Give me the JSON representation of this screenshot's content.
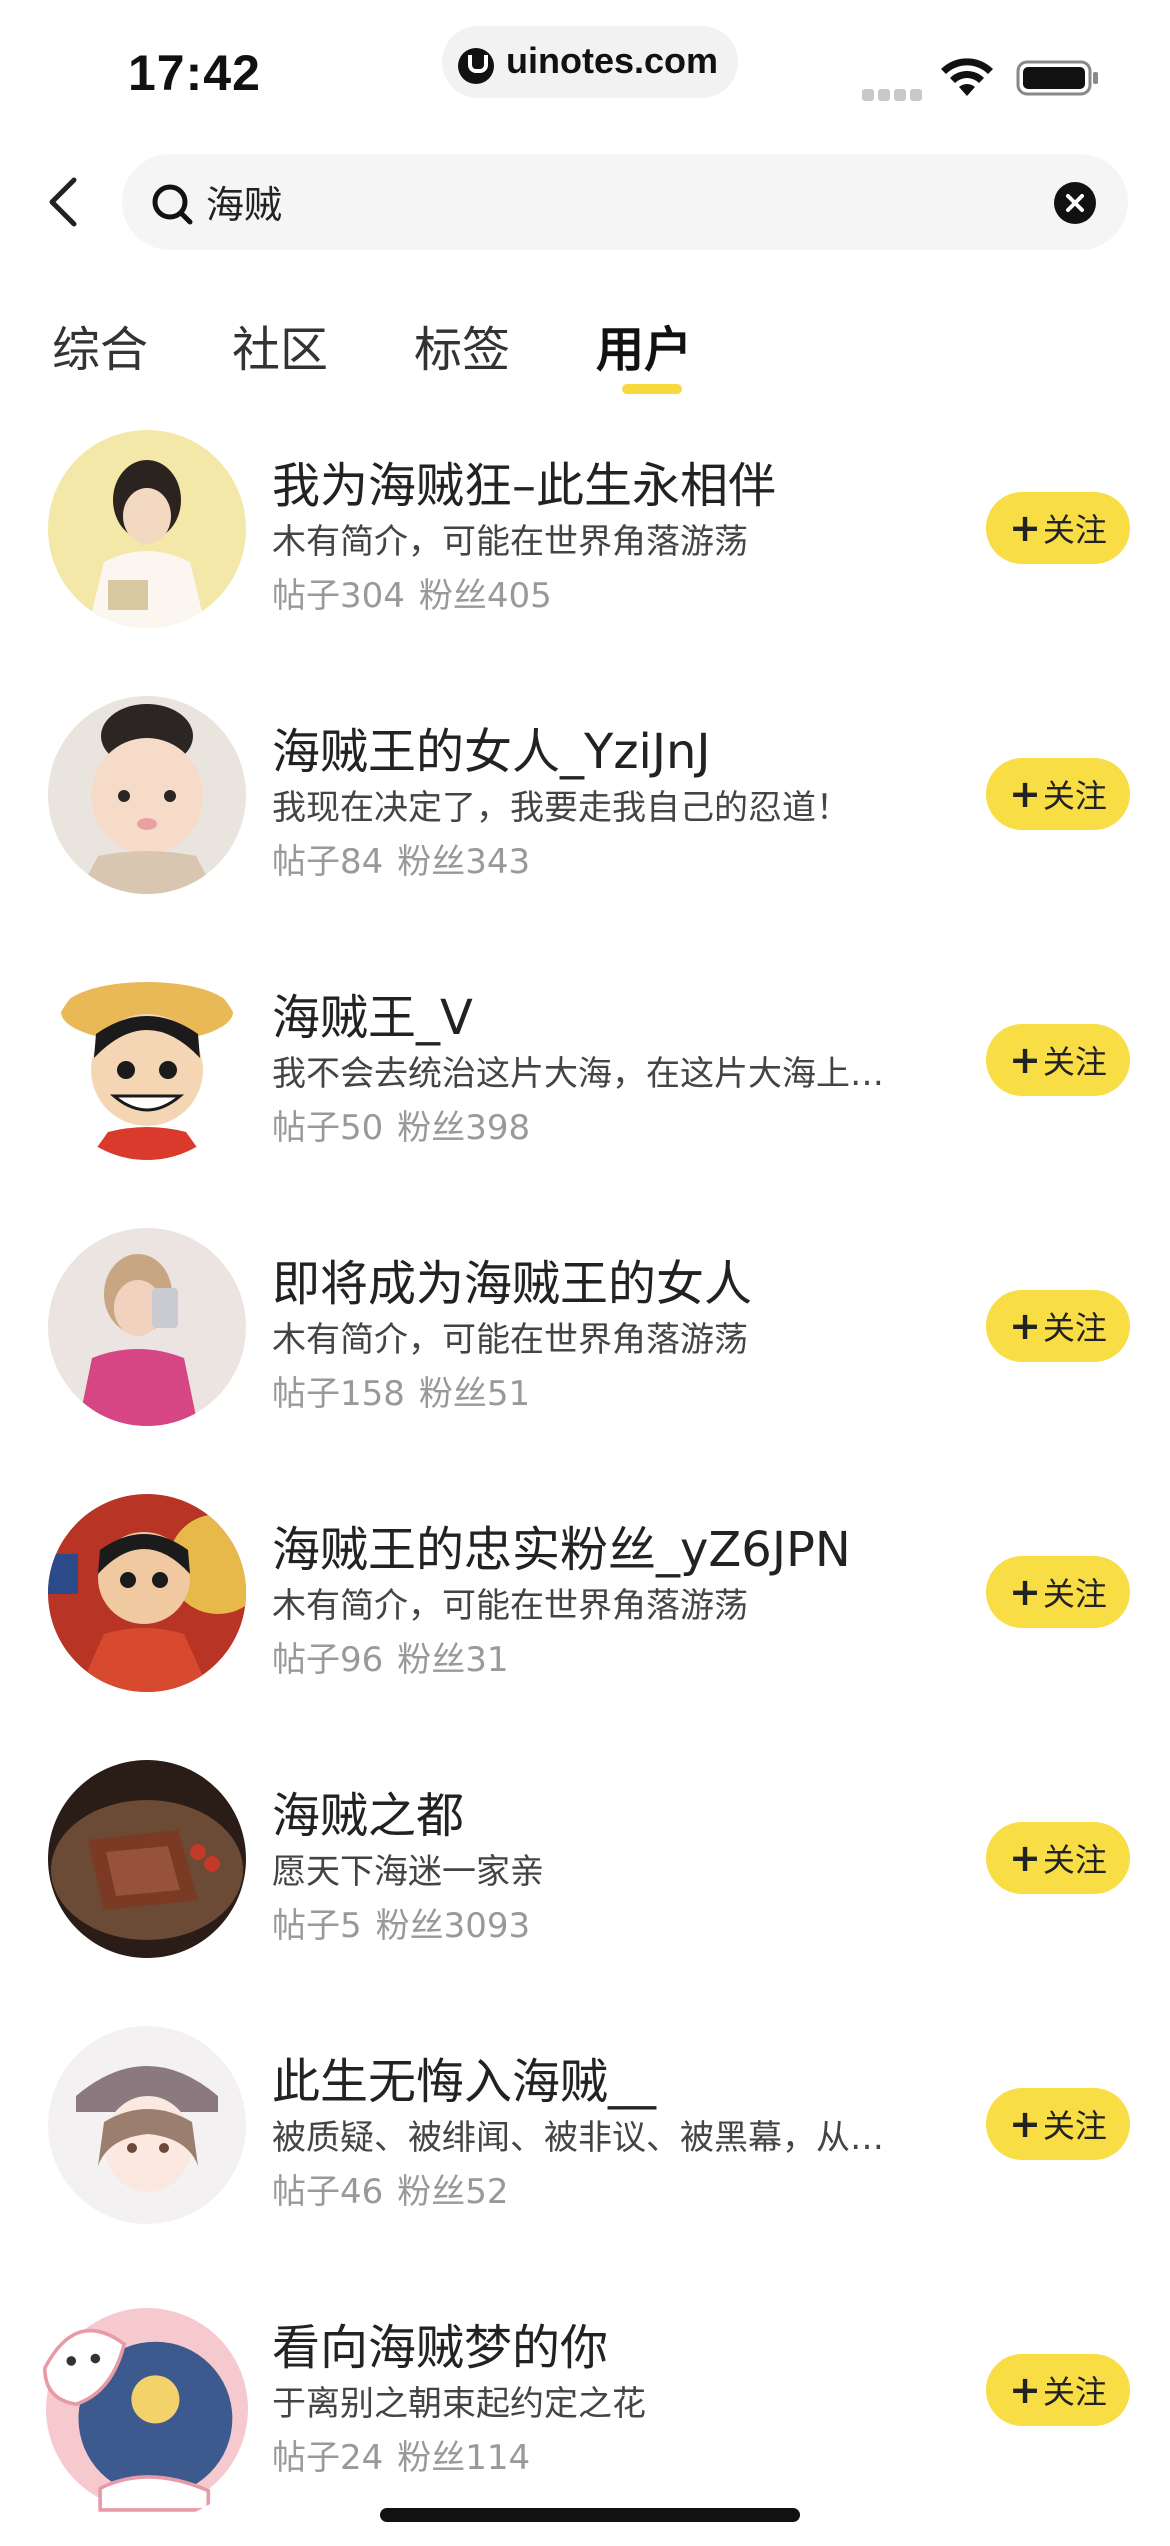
{
  "status_bar": {
    "time": "17:42",
    "url": "uinotes.com",
    "icons": [
      "signal-icon",
      "wifi-icon",
      "battery-icon"
    ]
  },
  "search": {
    "back_icon": "back-arrow-icon",
    "query": "海贼",
    "clear_icon": "clear-icon"
  },
  "tabs": [
    {
      "label": "综合",
      "active": false
    },
    {
      "label": "社区",
      "active": false
    },
    {
      "label": "标签",
      "active": false
    },
    {
      "label": "用户",
      "active": true
    }
  ],
  "colors": {
    "accent": "#f8dd44",
    "indicator": "#f7d93d",
    "stats_gray": "#999999"
  },
  "follow_label": "关注",
  "users": [
    {
      "name": "我为海贼狂–此生永相伴",
      "bio": "木有简介，可能在世界角落游荡",
      "posts": "帖子304",
      "fans": "粉丝405"
    },
    {
      "name": "海贼王的女人_YziJnJ",
      "bio": "我现在决定了，我要走我自己的忍道！",
      "posts": "帖子84",
      "fans": "粉丝343"
    },
    {
      "name": "海贼王_V",
      "bio": "我不会去统治这片大海，在这片大海上…",
      "posts": "帖子50",
      "fans": "粉丝398"
    },
    {
      "name": "即将成为海贼王的女人",
      "bio": "木有简介，可能在世界角落游荡",
      "posts": "帖子158",
      "fans": "粉丝51"
    },
    {
      "name": "海贼王的忠实粉丝_yZ6JPN",
      "bio": "木有简介，可能在世界角落游荡",
      "posts": "帖子96",
      "fans": "粉丝31"
    },
    {
      "name": "海贼之都",
      "bio": "愿天下海迷一家亲",
      "posts": "帖子5",
      "fans": "粉丝3093"
    },
    {
      "name": "此生无悔入海贼__",
      "bio": "被质疑、被绯闻、被非议、被黑幕，从…",
      "posts": "帖子46",
      "fans": "粉丝52"
    },
    {
      "name": "看向海贼梦的你",
      "bio": "于离别之朝束起约定之花",
      "posts": "帖子24",
      "fans": "粉丝114"
    }
  ]
}
